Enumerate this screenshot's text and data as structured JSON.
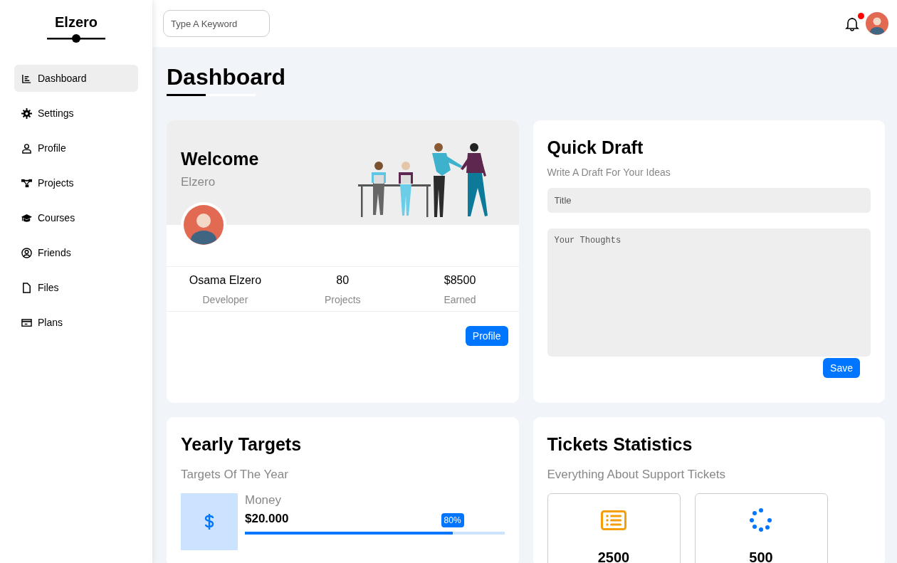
{
  "sidebar": {
    "brand": "Elzero",
    "items": [
      {
        "label": "Dashboard",
        "selected": true
      },
      {
        "label": "Settings",
        "selected": false
      },
      {
        "label": "Profile",
        "selected": false
      },
      {
        "label": "Projects",
        "selected": false
      },
      {
        "label": "Courses",
        "selected": false
      },
      {
        "label": "Friends",
        "selected": false
      },
      {
        "label": "Files",
        "selected": false
      },
      {
        "label": "Plans",
        "selected": false
      }
    ]
  },
  "header": {
    "search": {
      "placeholder": "Type A Keyword"
    },
    "notifications": {
      "unread": true
    }
  },
  "page_title": "Dashboard",
  "welcome": {
    "title": "Welcome",
    "subtitle": "Elzero",
    "stats": [
      {
        "value": "Osama Elzero",
        "label": "Developer"
      },
      {
        "value": "80",
        "label": "Projects"
      },
      {
        "value": "$8500",
        "label": "Earned"
      }
    ],
    "button": "Profile"
  },
  "quick_draft": {
    "title": "Quick Draft",
    "subtitle": "Write A Draft For Your Ideas",
    "fields": [
      {
        "kind": "input",
        "placeholder": "Title"
      },
      {
        "kind": "textarea",
        "placeholder": "Your Thoughts"
      }
    ],
    "button": "Save"
  },
  "yearly_targets": {
    "title": "Yearly Targets",
    "subtitle": "Targets Of The Year",
    "targets": [
      {
        "label": "Money",
        "value": "$20.000",
        "reading": "80%",
        "level": 0.8
      }
    ]
  },
  "tickets": {
    "title": "Tickets Statistics",
    "subtitle": "Everything About Support Tickets",
    "stats": [
      {
        "value": "2500",
        "color": "#f59e0b"
      },
      {
        "value": "500",
        "color": "#0075ff"
      }
    ]
  }
}
